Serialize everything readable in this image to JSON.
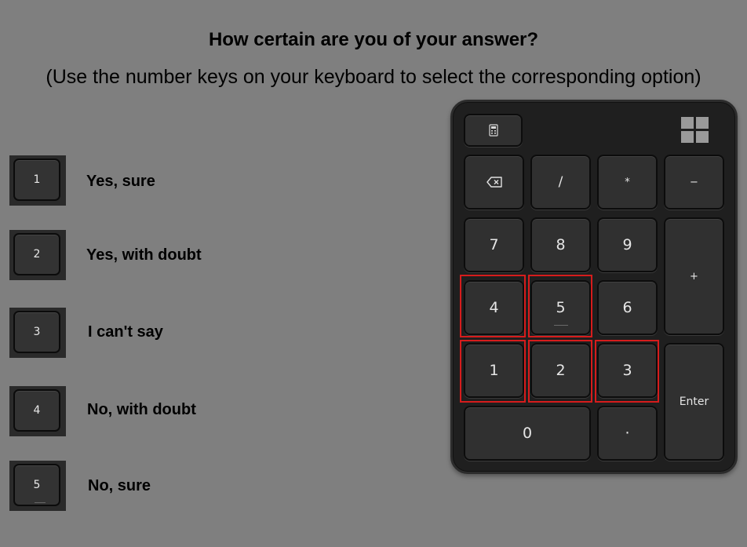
{
  "title": "How certain are you of your answer?",
  "instruction": "(Use the number keys on your keyboard to select the corresponding option)",
  "options": [
    {
      "key": "1",
      "label": "Yes, sure"
    },
    {
      "key": "2",
      "label": "Yes, with doubt"
    },
    {
      "key": "3",
      "label": "I can't say"
    },
    {
      "key": "4",
      "label": "No, with doubt"
    },
    {
      "key": "5",
      "label": "No, sure"
    }
  ],
  "numpad": {
    "calculator_icon": "calculator-icon",
    "windows_icon": "windows-logo-icon",
    "backspace_icon": "backspace-icon",
    "keys": {
      "slash": "/",
      "asterisk": "*",
      "minus": "−",
      "seven": "7",
      "eight": "8",
      "nine": "9",
      "plus": "+",
      "four": "4",
      "five": "5",
      "six": "6",
      "one": "1",
      "two": "2",
      "three": "3",
      "enter": "Enter",
      "zero": "0",
      "dot": "·"
    },
    "highlighted_keys": [
      "1",
      "2",
      "3",
      "4",
      "5"
    ],
    "highlight_color": "#d61c1c"
  }
}
